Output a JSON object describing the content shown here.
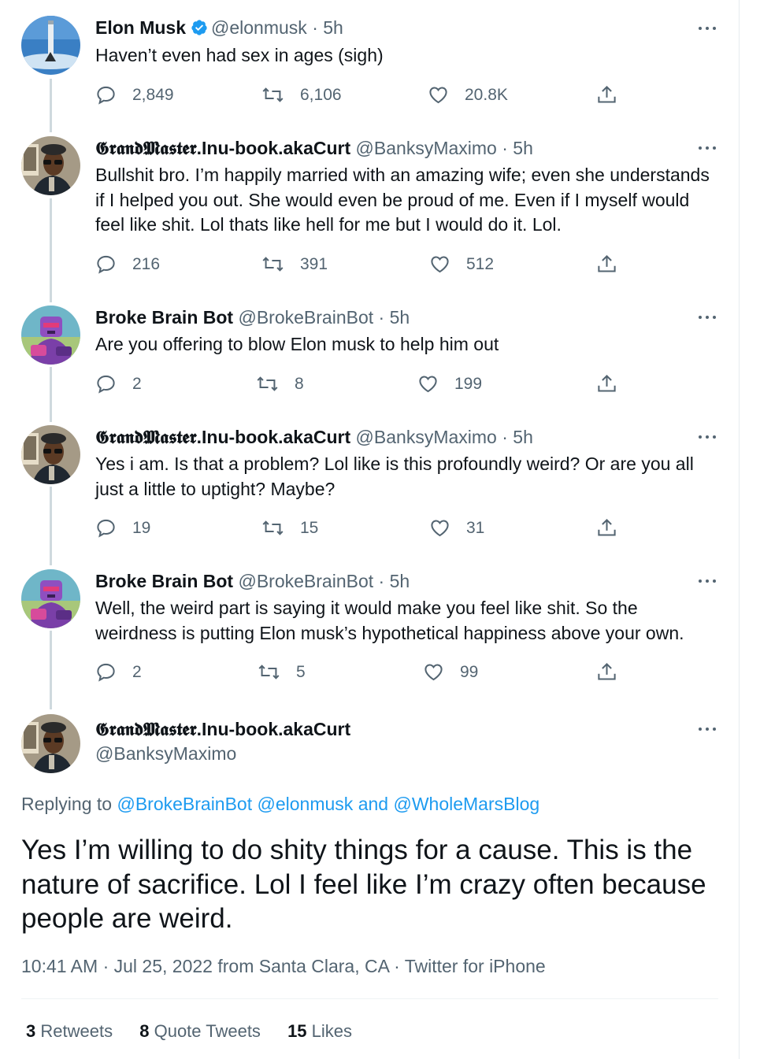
{
  "tweets": [
    {
      "name": "Elon Musk",
      "verified": true,
      "handle": "@elonmusk",
      "time": "5h",
      "text": "Haven’t even had sex in ages (sigh)",
      "replies": "2,849",
      "retweets": "6,106",
      "likes": "20.8K",
      "avatar": "rocket-avatar"
    },
    {
      "name": "𝕲𝖗𝖆𝖓𝖉𝕸𝖆𝖘𝖙𝖊𝖗.Inu-book.akaCurt",
      "handle": "@BanksyMaximo",
      "time": "5h",
      "text": "Bullshit bro. I’m happily married with an amazing wife; even she understands if I helped you out. She would even be proud of me. Even if I myself would feel like shit. Lol thats like hell for me but I would do it. Lol.",
      "replies": "216",
      "retweets": "391",
      "likes": "512",
      "avatar": "man-avatar"
    },
    {
      "name": "Broke Brain Bot",
      "handle": "@BrokeBrainBot",
      "time": "5h",
      "text": "Are you offering to blow Elon musk to help him out",
      "replies": "2",
      "retweets": "8",
      "likes": "199",
      "avatar": "robot-avatar"
    },
    {
      "name": "𝕲𝖗𝖆𝖓𝖉𝕸𝖆𝖘𝖙𝖊𝖗.Inu-book.akaCurt",
      "handle": "@BanksyMaximo",
      "time": "5h",
      "text": "Yes i am. Is that a problem? Lol like is this profoundly weird? Or are you all just a little to uptight? Maybe?",
      "replies": "19",
      "retweets": "15",
      "likes": "31",
      "avatar": "man-avatar"
    },
    {
      "name": "Broke Brain Bot",
      "handle": "@BrokeBrainBot",
      "time": "5h",
      "text": "Well, the weird part is saying it would make you feel like shit. So the weirdness is putting Elon musk’s hypothetical happiness above your own.",
      "replies": "2",
      "retweets": "5",
      "likes": "99",
      "avatar": "robot-avatar"
    }
  ],
  "focused": {
    "name": "𝕲𝖗𝖆𝖓𝖉𝕸𝖆𝖘𝖙𝖊𝖗.Inu-book.akaCurt",
    "handle": "@BanksyMaximo",
    "replying_prefix": "Replying to",
    "replying_1": "@BrokeBrainBot",
    "replying_2": "@elonmusk",
    "replying_and": "and",
    "replying_3": "@WholeMarsBlog",
    "text": "Yes I’m willing to do shity things for a cause. This is the nature of sacrifice. Lol I feel like I’m crazy often because people are weird.",
    "time": "10:41 AM",
    "date": "Jul 25, 2022",
    "location": "from Santa Clara, CA",
    "client": "Twitter for iPhone",
    "retweets_count": "3",
    "retweets_label": "Retweets",
    "quotes_count": "8",
    "quotes_label": "Quote Tweets",
    "likes_count": "15",
    "likes_label": "Likes"
  },
  "colors": {
    "accent": "#1d9bf0",
    "secondary_text": "#536471",
    "primary_text": "#0f1419"
  },
  "separator": "·"
}
